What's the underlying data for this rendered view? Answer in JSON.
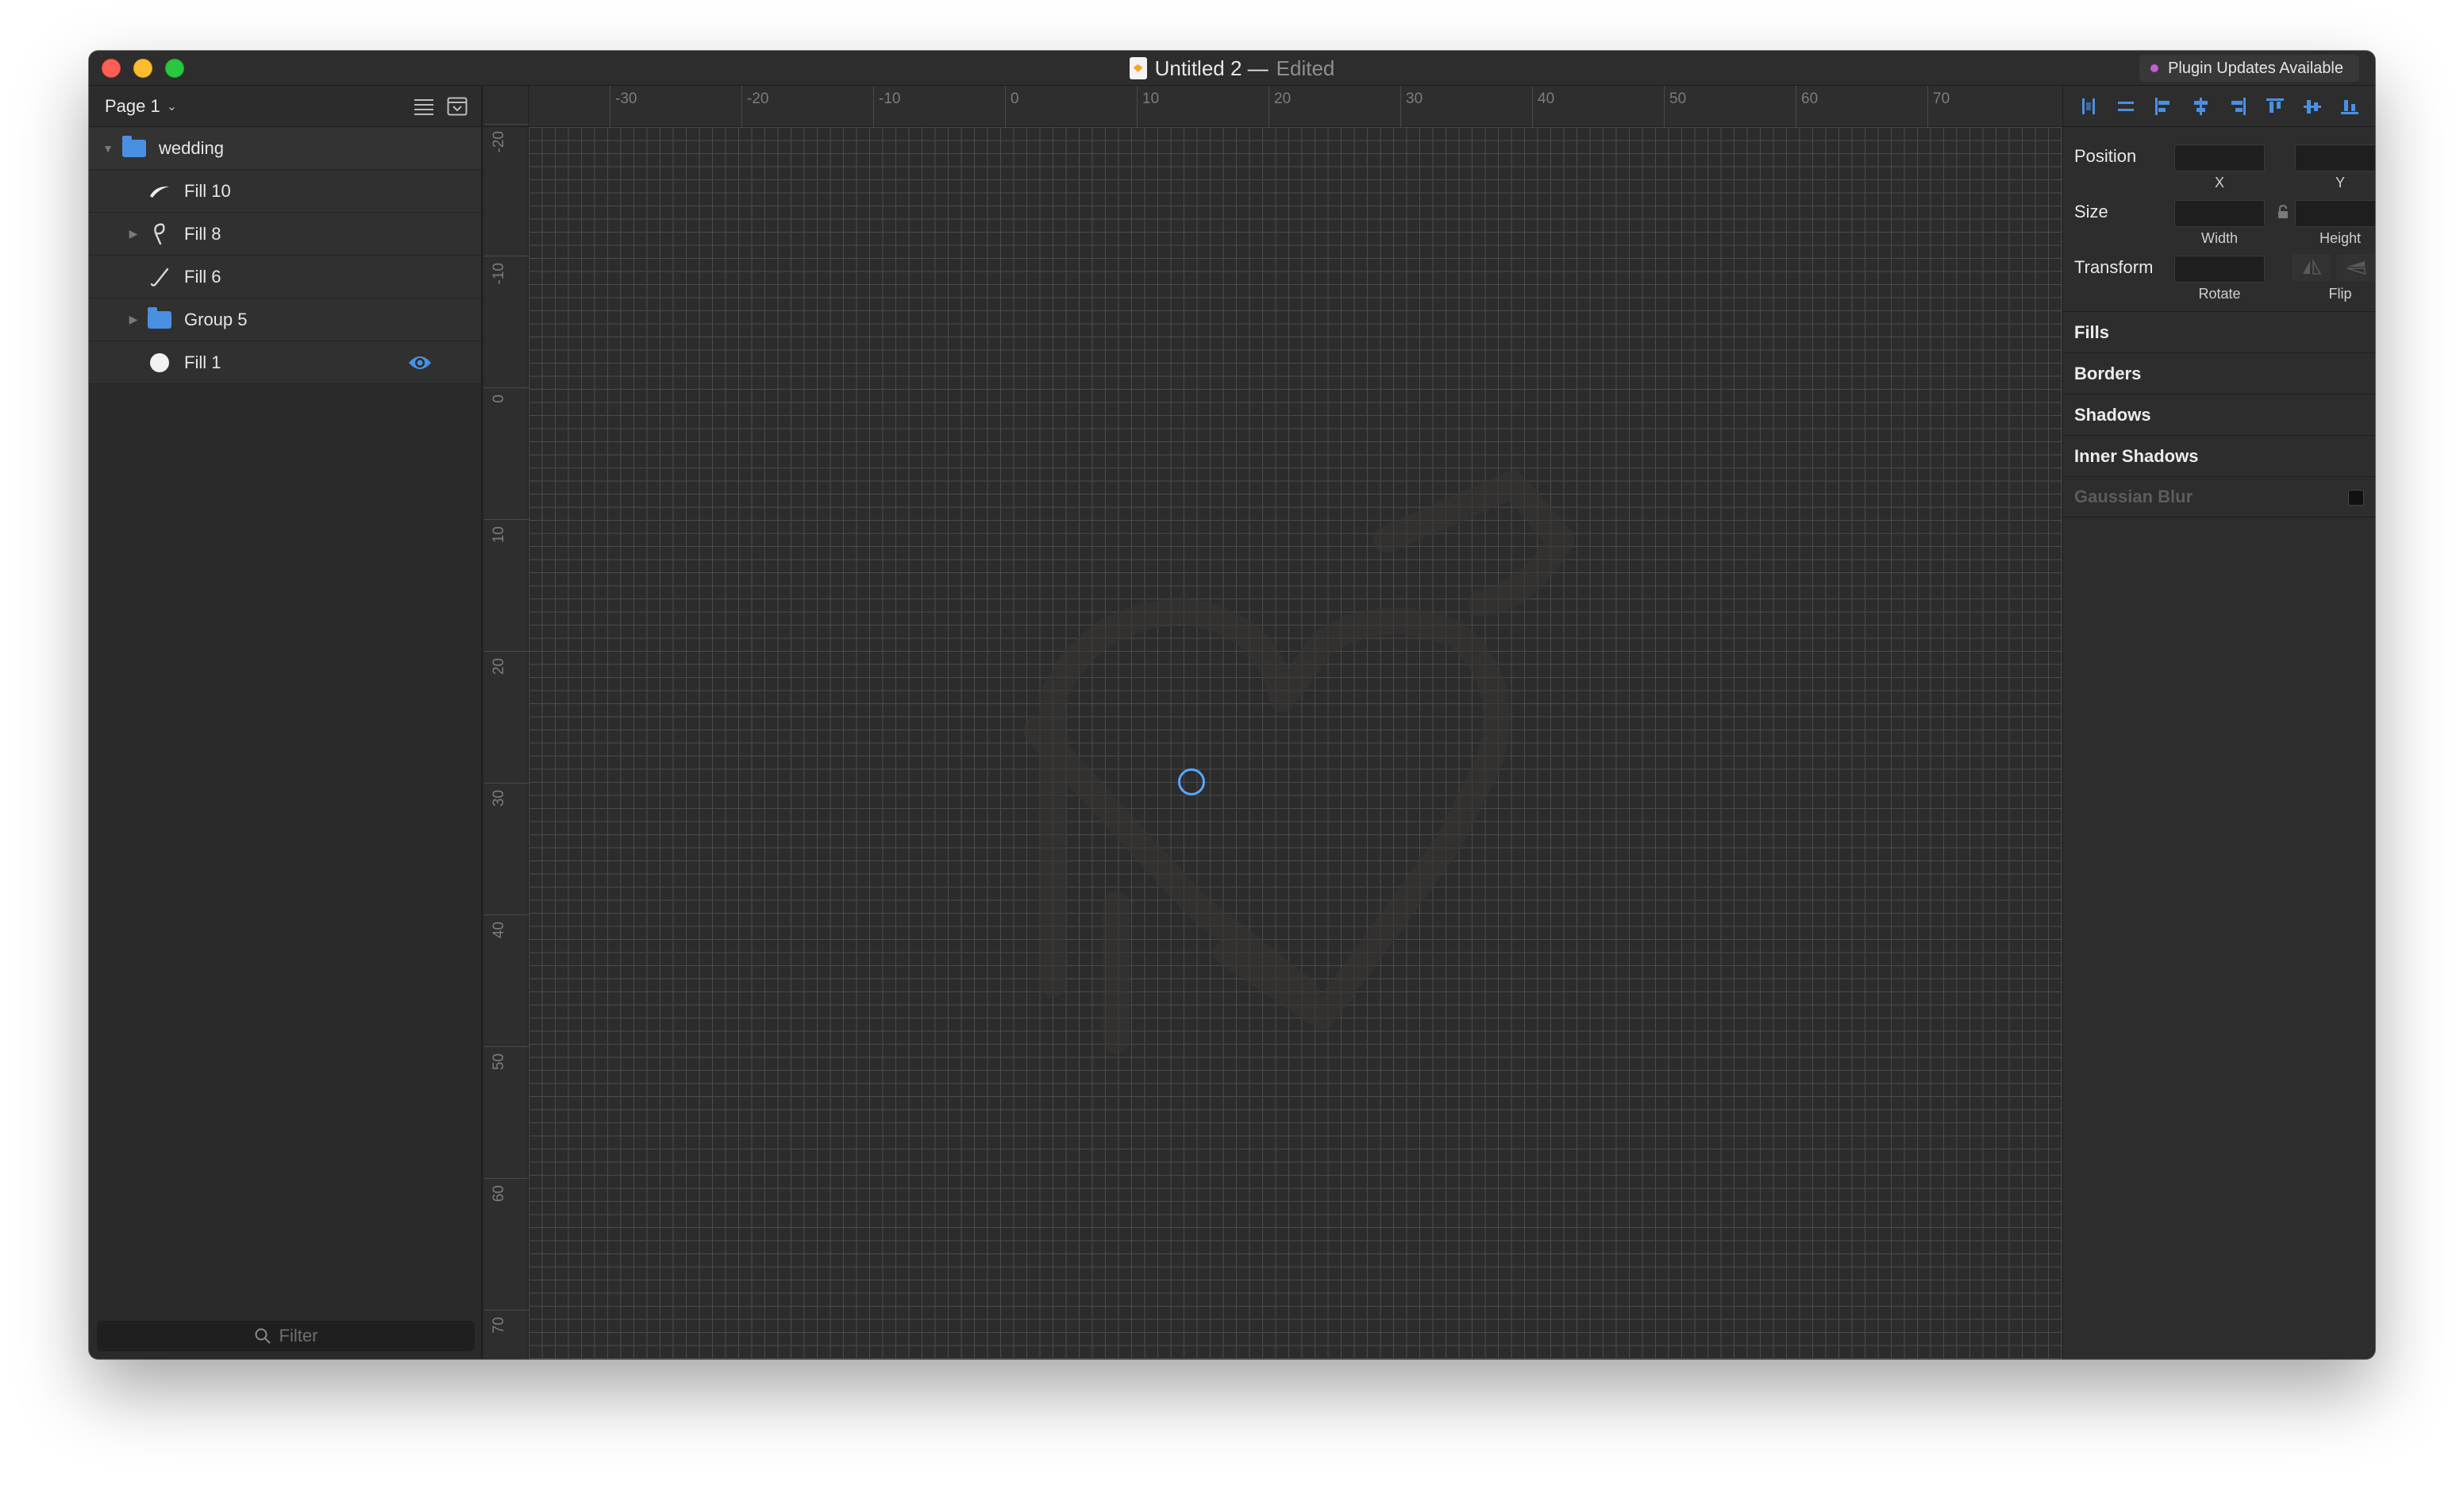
{
  "window": {
    "title": "Untitled 2 —",
    "status": "Edited",
    "plugin_badge": "Plugin Updates Available"
  },
  "sidebar": {
    "page_label": "Page 1",
    "layers": [
      {
        "name": "wedding",
        "type": "group",
        "expanded": true
      },
      {
        "name": "Fill 10",
        "type": "path-arc"
      },
      {
        "name": "Fill 8",
        "type": "path-curl",
        "collapsed": true
      },
      {
        "name": "Fill 6",
        "type": "path-check"
      },
      {
        "name": "Group 5",
        "type": "group",
        "collapsed": true
      },
      {
        "name": "Fill 1",
        "type": "oval",
        "visible_icon": true
      }
    ],
    "filter_placeholder": "Filter"
  },
  "rulers": {
    "top": [
      "-30",
      "-20",
      "-10",
      "0",
      "10",
      "20",
      "30",
      "40",
      "50",
      "60",
      "70"
    ],
    "left": [
      "-20",
      "-10",
      "0",
      "10",
      "20",
      "30",
      "40",
      "50",
      "60",
      "70"
    ]
  },
  "inspector": {
    "position_label": "Position",
    "x_caption": "X",
    "y_caption": "Y",
    "size_label": "Size",
    "width_caption": "Width",
    "height_caption": "Height",
    "transform_label": "Transform",
    "rotate_caption": "Rotate",
    "flip_caption": "Flip",
    "sections": [
      "Fills",
      "Borders",
      "Shadows",
      "Inner Shadows"
    ],
    "gaussian_blur": "Gaussian Blur"
  },
  "colors": {
    "accent": "#4a90e2",
    "cursor_ring": "#58a6ff",
    "plugin_dot": "#c65bd6"
  }
}
